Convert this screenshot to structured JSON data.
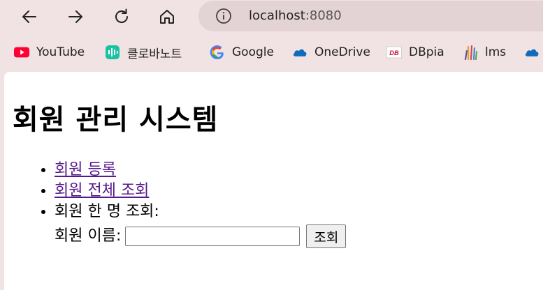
{
  "browser": {
    "address_bar": {
      "host": "localhost",
      "port": ":8080"
    },
    "bookmarks": [
      {
        "label": "YouTube",
        "icon": "youtube-icon"
      },
      {
        "label": "클로바노트",
        "icon": "clova-note-icon"
      },
      {
        "label": "Google",
        "icon": "google-icon"
      },
      {
        "label": "OneDrive",
        "icon": "onedrive-icon"
      },
      {
        "label": "DBpia",
        "icon": "dbpia-icon"
      },
      {
        "label": "lms",
        "icon": "lms-icon"
      }
    ]
  },
  "page": {
    "title": "회원 관리 시스템",
    "menu": {
      "register_link": "회원 등록",
      "list_all_link": "회원 전체 조회",
      "find_one_label": "회원 한 명 조회:",
      "name_label": "회원 이름:",
      "name_input_value": "",
      "search_button": "조회"
    }
  },
  "colors": {
    "browser_chrome": "#f1e2e3",
    "address_bar_bg": "#e4d3d5",
    "visited_link": "#551a8b"
  }
}
